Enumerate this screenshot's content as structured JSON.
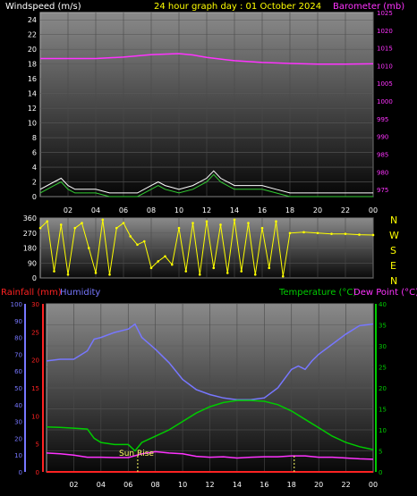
{
  "header": {
    "left_title": "Windspeed (m/s)",
    "center_title": "24 hour graph day : 01 October 2024",
    "right_title": "Barometer (mb)"
  },
  "middle": {
    "compass": [
      "N",
      "W",
      "S",
      "E",
      "N"
    ]
  },
  "bottom_header": {
    "rainfall": "Rainfall (mm)",
    "humidity": "Humidity",
    "temperature": "Temperature (°C)",
    "dewpoint": "Dew Point (°C)"
  },
  "sunrise_label": "Sun Rise",
  "colors": {
    "wind": "#ffffff",
    "gust_avg": "#33cc33",
    "barometer": "#ff33ff",
    "direction": "#ffff00",
    "humidity": "#7777ff",
    "temperature": "#00cc00",
    "dewpoint": "#ff33ff",
    "rainfall": "#ff2222",
    "sunrise_marker": "#ffff66"
  },
  "x_tick_labels": [
    "02",
    "04",
    "06",
    "08",
    "10",
    "12",
    "14",
    "16",
    "18",
    "20",
    "22",
    "00"
  ],
  "chart_data": [
    {
      "type": "line",
      "name": "wind_barometer",
      "x_range_hours": [
        0,
        24
      ],
      "left_axis": {
        "label": "Windspeed (m/s)",
        "range": [
          0,
          25
        ],
        "ticks": [
          "0",
          "2",
          "4",
          "6",
          "8",
          "10",
          "12",
          "14",
          "16",
          "18",
          "20",
          "22",
          "24"
        ]
      },
      "right_axis": {
        "label": "Barometer (mb)",
        "range": [
          973,
          1025
        ],
        "ticks": [
          "975",
          "980",
          "985",
          "990",
          "995",
          "1000",
          "1005",
          "1010",
          "1015",
          "1020",
          "1025"
        ]
      },
      "series": [
        {
          "name": "Windspeed (m/s)",
          "axis": "left",
          "x": [
            0,
            1,
            1.5,
            2,
            2.5,
            3,
            4,
            5,
            6,
            7,
            8,
            8.5,
            9,
            10,
            11,
            12,
            12.5,
            13,
            14,
            15,
            16,
            17,
            18,
            19,
            20,
            21,
            22,
            23,
            24
          ],
          "y": [
            1,
            2,
            2.5,
            1.5,
            1,
            1,
            1,
            0.5,
            0.5,
            0.5,
            1.5,
            2,
            1.5,
            1,
            1.5,
            2.5,
            3.5,
            2.5,
            1.5,
            1.5,
            1.5,
            1,
            0.5,
            0.5,
            0.5,
            0.5,
            0.5,
            0.5,
            0.5
          ]
        },
        {
          "name": "Barometer (mb)",
          "axis": "right",
          "x": [
            0,
            2,
            4,
            6,
            8,
            10,
            11,
            12,
            14,
            16,
            18,
            20,
            22,
            24
          ],
          "y": [
            1012,
            1012,
            1012,
            1012.4,
            1013.1,
            1013.4,
            1013,
            1012.3,
            1011.4,
            1010.9,
            1010.6,
            1010.4,
            1010.4,
            1010.5
          ]
        }
      ]
    },
    {
      "type": "scatter",
      "name": "wind_direction",
      "y_axis": {
        "range": [
          0,
          360
        ],
        "ticks": [
          "0",
          "90",
          "180",
          "270",
          "360"
        ]
      },
      "series": [
        {
          "name": "Wind direction (deg)",
          "x": [
            0,
            0.5,
            1,
            1.5,
            2,
            2.5,
            3,
            3.5,
            4,
            4.5,
            5,
            5.5,
            6,
            6.5,
            7,
            7.5,
            8,
            8.5,
            9,
            9.5,
            10,
            10.5,
            11,
            11.5,
            12,
            12.5,
            13,
            13.5,
            14,
            14.5,
            15,
            15.5,
            16,
            16.5,
            17,
            17.5,
            18,
            19,
            20,
            21,
            22,
            23,
            24
          ],
          "y": [
            300,
            340,
            40,
            320,
            20,
            300,
            330,
            180,
            30,
            350,
            20,
            300,
            330,
            250,
            200,
            220,
            60,
            100,
            130,
            80,
            300,
            40,
            330,
            20,
            340,
            60,
            320,
            30,
            350,
            40,
            330,
            20,
            300,
            60,
            340,
            10,
            270,
            275,
            270,
            265,
            265,
            260,
            258
          ]
        }
      ]
    },
    {
      "type": "line",
      "name": "temp_humidity_rain",
      "left_axes": [
        {
          "label": "Humidity",
          "range": [
            0,
            100
          ],
          "ticks": [
            "0",
            "10",
            "20",
            "30",
            "40",
            "50",
            "60",
            "70",
            "80",
            "90",
            "100"
          ]
        },
        {
          "label": "Rainfall (mm)",
          "range": [
            0,
            30
          ],
          "ticks": [
            "0",
            "5",
            "10",
            "15",
            "20",
            "25",
            "30"
          ]
        }
      ],
      "right_axis": {
        "label": "Temperature (°C)",
        "range": [
          0,
          40
        ],
        "ticks": [
          "0",
          "5",
          "10",
          "15",
          "20",
          "25",
          "30",
          "35",
          "40"
        ]
      },
      "series": [
        {
          "name": "Humidity",
          "axis": "humidity",
          "x": [
            0,
            1,
            2,
            3,
            3.5,
            4,
            5,
            6,
            6.5,
            7,
            8,
            9,
            10,
            11,
            12,
            13,
            14,
            15,
            16,
            17,
            18,
            18.5,
            19,
            19.5,
            20,
            21,
            22,
            23,
            24
          ],
          "y": [
            66,
            67,
            67,
            72,
            79,
            80,
            83,
            85,
            88,
            80,
            73,
            65,
            55,
            49,
            46,
            44,
            43,
            43,
            44,
            50,
            61,
            63,
            61,
            66,
            70,
            76,
            82,
            87,
            88
          ]
        },
        {
          "name": "Temperature (°C)",
          "axis": "right",
          "x": [
            0,
            1,
            2,
            3,
            3.5,
            4,
            5,
            6,
            6.5,
            7,
            8,
            9,
            10,
            11,
            12,
            13,
            14,
            15,
            16,
            17,
            18,
            19,
            20,
            21,
            22,
            23,
            24
          ],
          "y": [
            10.7,
            10.6,
            10.4,
            10.2,
            8,
            7,
            6.5,
            6.5,
            5,
            7,
            8.5,
            10,
            12,
            14,
            15.5,
            16.5,
            17,
            17,
            16.8,
            16,
            14.5,
            12.5,
            10.5,
            8.5,
            7,
            6,
            5.3
          ]
        },
        {
          "name": "Dew Point (°C)",
          "axis": "right",
          "x": [
            0,
            1,
            2,
            3,
            4,
            5,
            6,
            7,
            8,
            9,
            10,
            11,
            12,
            13,
            14,
            15,
            16,
            17,
            18,
            19,
            20,
            21,
            22,
            23,
            24
          ],
          "y": [
            4.5,
            4.3,
            4,
            3.5,
            3.5,
            3.4,
            3.4,
            4.3,
            4.8,
            4.5,
            4.3,
            3.7,
            3.5,
            3.6,
            3.3,
            3.5,
            3.6,
            3.6,
            3.8,
            3.8,
            3.5,
            3.5,
            3.3,
            3.1,
            3
          ]
        },
        {
          "name": "Rainfall (mm)",
          "axis": "rainfall",
          "x": [
            0,
            24
          ],
          "y": [
            0,
            0
          ]
        }
      ],
      "annotations": [
        {
          "label": "Sun Rise",
          "x": 6.7
        },
        {
          "x": 18.2
        }
      ]
    }
  ]
}
